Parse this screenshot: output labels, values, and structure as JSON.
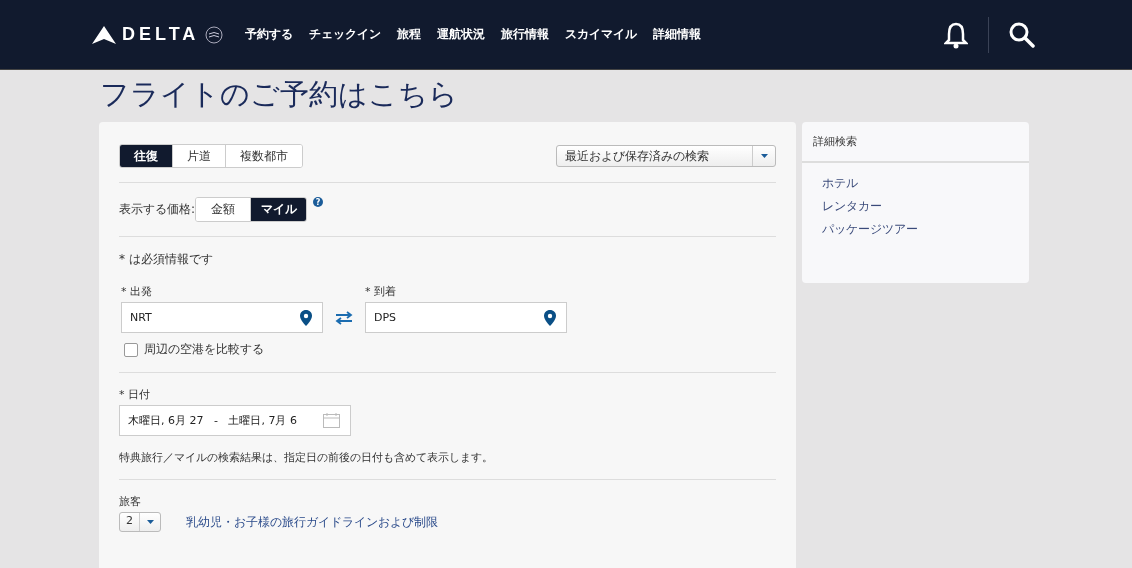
{
  "header": {
    "logo": "DELTA",
    "nav": [
      "予約する",
      "チェックイン",
      "旅程",
      "運航状況",
      "旅行情報",
      "スカイマイル",
      "詳細情報"
    ]
  },
  "title": "フライトのご予約はこちら",
  "trip_types": [
    {
      "label": "往復",
      "selected": true
    },
    {
      "label": "片道",
      "selected": false
    },
    {
      "label": "複数都市",
      "selected": false
    }
  ],
  "recent_searches": {
    "value": "最近および保存済みの検索"
  },
  "price_display": {
    "label": "表示する価格:",
    "options": [
      {
        "label": "金額",
        "selected": false
      },
      {
        "label": "マイル",
        "selected": true
      }
    ],
    "help": "?"
  },
  "required_note": "* は必須情報です",
  "origin": {
    "label": "* 出発",
    "value": "NRT"
  },
  "destination": {
    "label": "* 到着",
    "value": "DPS"
  },
  "nearby": {
    "label": "周辺の空港を比較する",
    "checked": false
  },
  "dates": {
    "label": "* 日付",
    "value": "木曜日, 6月 27   -   土曜日, 7月 6"
  },
  "award_note": "特典旅行／マイルの検索結果は、指定日の前後の日付も含めて表示します。",
  "passengers": {
    "label": "旅客",
    "value": "2",
    "link": "乳幼児・お子様の旅行ガイドラインおよび制限"
  },
  "sidebar": {
    "title": "詳細検索",
    "links": [
      "ホテル",
      "レンタカー",
      "パッケージツアー"
    ]
  }
}
